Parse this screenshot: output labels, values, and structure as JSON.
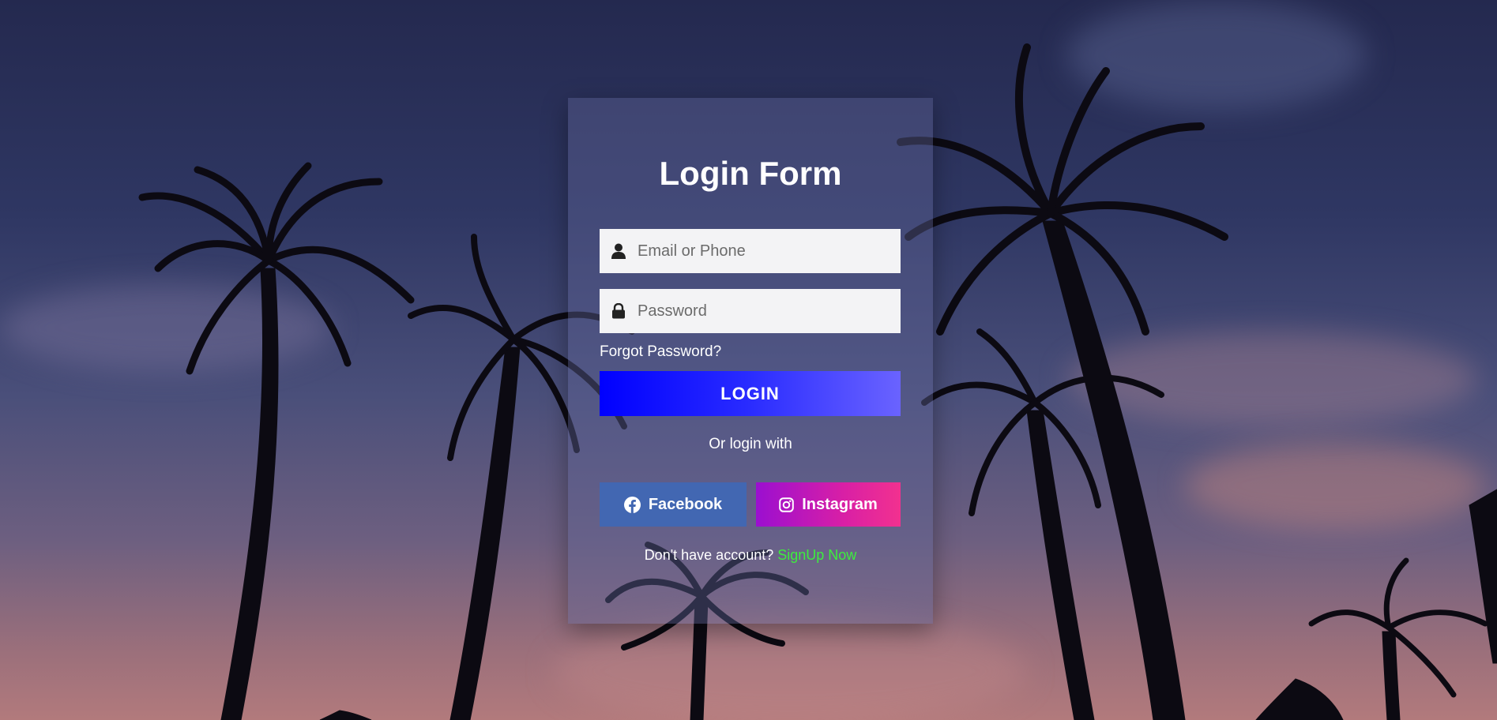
{
  "form": {
    "title": "Login Form",
    "email_placeholder": "Email or Phone",
    "password_placeholder": "Password",
    "forgot_label": "Forgot Password?",
    "login_label": "LOGIN",
    "or_label": "Or login with",
    "facebook_label": "Facebook",
    "instagram_label": "Instagram",
    "no_account_text": "Don't have account?",
    "signup_label": "SignUp Now"
  },
  "icons": {
    "user": "user-icon",
    "lock": "lock-icon",
    "facebook": "facebook-icon",
    "instagram": "instagram-icon"
  },
  "colors": {
    "login_gradient_start": "#0000ff",
    "login_gradient_end": "#6a63ff",
    "facebook": "#4267b2",
    "instagram_start": "#9b0fd0",
    "instagram_end": "#f2318f",
    "signup_link": "#3dee3d"
  }
}
